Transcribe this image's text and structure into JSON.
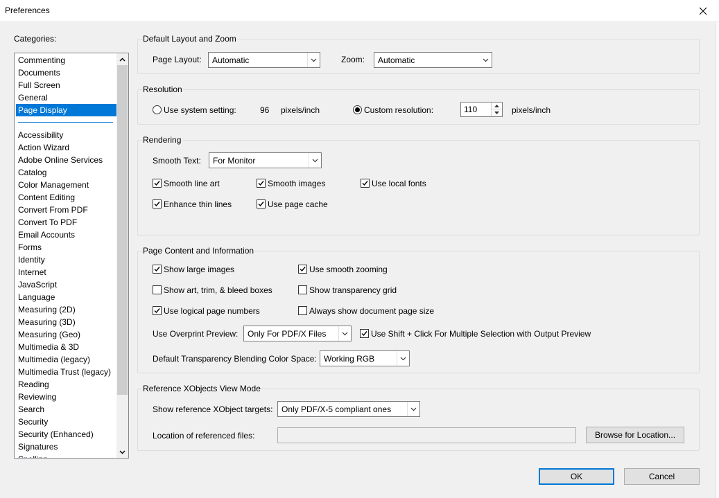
{
  "window": {
    "title": "Preferences"
  },
  "categories": {
    "label": "Categories:",
    "items": [
      "Commenting",
      "Documents",
      "Full Screen",
      "General",
      "Page Display",
      "Accessibility",
      "Action Wizard",
      "Adobe Online Services",
      "Catalog",
      "Color Management",
      "Content Editing",
      "Convert From PDF",
      "Convert To PDF",
      "Email Accounts",
      "Forms",
      "Identity",
      "Internet",
      "JavaScript",
      "Language",
      "Measuring (2D)",
      "Measuring (3D)",
      "Measuring (Geo)",
      "Multimedia & 3D",
      "Multimedia (legacy)",
      "Multimedia Trust (legacy)",
      "Reading",
      "Reviewing",
      "Search",
      "Security",
      "Security (Enhanced)",
      "Signatures",
      "Spelling"
    ],
    "selected": "Page Display"
  },
  "layout_zoom": {
    "title": "Default Layout and Zoom",
    "page_layout_label": "Page Layout:",
    "page_layout_value": "Automatic",
    "zoom_label": "Zoom:",
    "zoom_value": "Automatic"
  },
  "resolution": {
    "title": "Resolution",
    "system_label": "Use system setting:",
    "system_value": "96",
    "system_unit": "pixels/inch",
    "custom_label": "Custom resolution:",
    "custom_value": "110",
    "custom_unit": "pixels/inch",
    "system_checked": false,
    "custom_checked": true
  },
  "rendering": {
    "title": "Rendering",
    "smooth_text_label": "Smooth Text:",
    "smooth_text_value": "For Monitor",
    "checkboxes": [
      {
        "label": "Smooth line art",
        "checked": true
      },
      {
        "label": "Smooth images",
        "checked": true
      },
      {
        "label": "Use local fonts",
        "checked": true
      },
      {
        "label": "Enhance thin lines",
        "checked": true
      },
      {
        "label": "Use page cache",
        "checked": true
      }
    ]
  },
  "page_content": {
    "title": "Page Content and Information",
    "checkboxes": [
      {
        "label": "Show large images",
        "checked": true
      },
      {
        "label": "Use smooth zooming",
        "checked": true
      },
      {
        "label": "Show art, trim, & bleed boxes",
        "checked": false
      },
      {
        "label": "Show transparency grid",
        "checked": false
      },
      {
        "label": "Use logical page numbers",
        "checked": true
      },
      {
        "label": "Always show document page size",
        "checked": false
      }
    ],
    "overprint_label": "Use Overprint Preview:",
    "overprint_value": "Only For PDF/X Files",
    "shift_click_label": "Use Shift + Click For Multiple Selection with Output Preview",
    "shift_click_checked": true,
    "blend_label": "Default Transparency Blending Color Space:",
    "blend_value": "Working RGB"
  },
  "xobjects": {
    "title": "Reference XObjects View Mode",
    "targets_label": "Show reference XObject targets:",
    "targets_value": "Only PDF/X-5 compliant ones",
    "location_label": "Location of referenced files:",
    "location_value": "",
    "browse_label": "Browse for Location..."
  },
  "buttons": {
    "ok": "OK",
    "cancel": "Cancel"
  },
  "colors": {
    "accent": "#0078d7",
    "background": "#f0f0f0"
  }
}
